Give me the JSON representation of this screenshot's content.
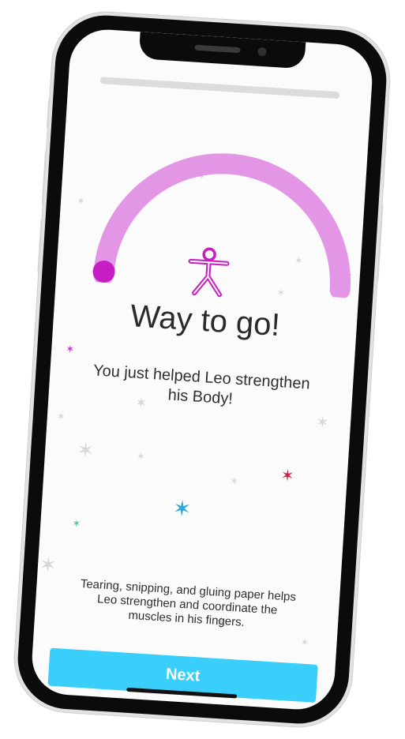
{
  "progress": {
    "fraction": 1.0
  },
  "gauge": {
    "value_fraction": 0.0,
    "color_track": "#e496e6",
    "color_knob": "#c51fc4"
  },
  "icon": {
    "name": "body-icon",
    "color": "#c51fc4"
  },
  "headline": "Way to go!",
  "subhead_line1": "You just helped Leo strengthen",
  "subhead_line2": "his Body!",
  "body_line1": "Tearing, snipping, and gluing paper helps",
  "body_line2": "Leo strengthen and coordinate the",
  "body_line3": "muscles in his fingers.",
  "next_label": "Next",
  "colors": {
    "accent_button": "#3acefa",
    "sparkle_gold": "#e0a62a",
    "sparkle_red": "#c8244c",
    "sparkle_magenta": "#c23ac7",
    "sparkle_blue": "#2aa9e0",
    "sparkle_teal": "#4fc7a9",
    "sparkle_grey": "#d8d8d8"
  }
}
